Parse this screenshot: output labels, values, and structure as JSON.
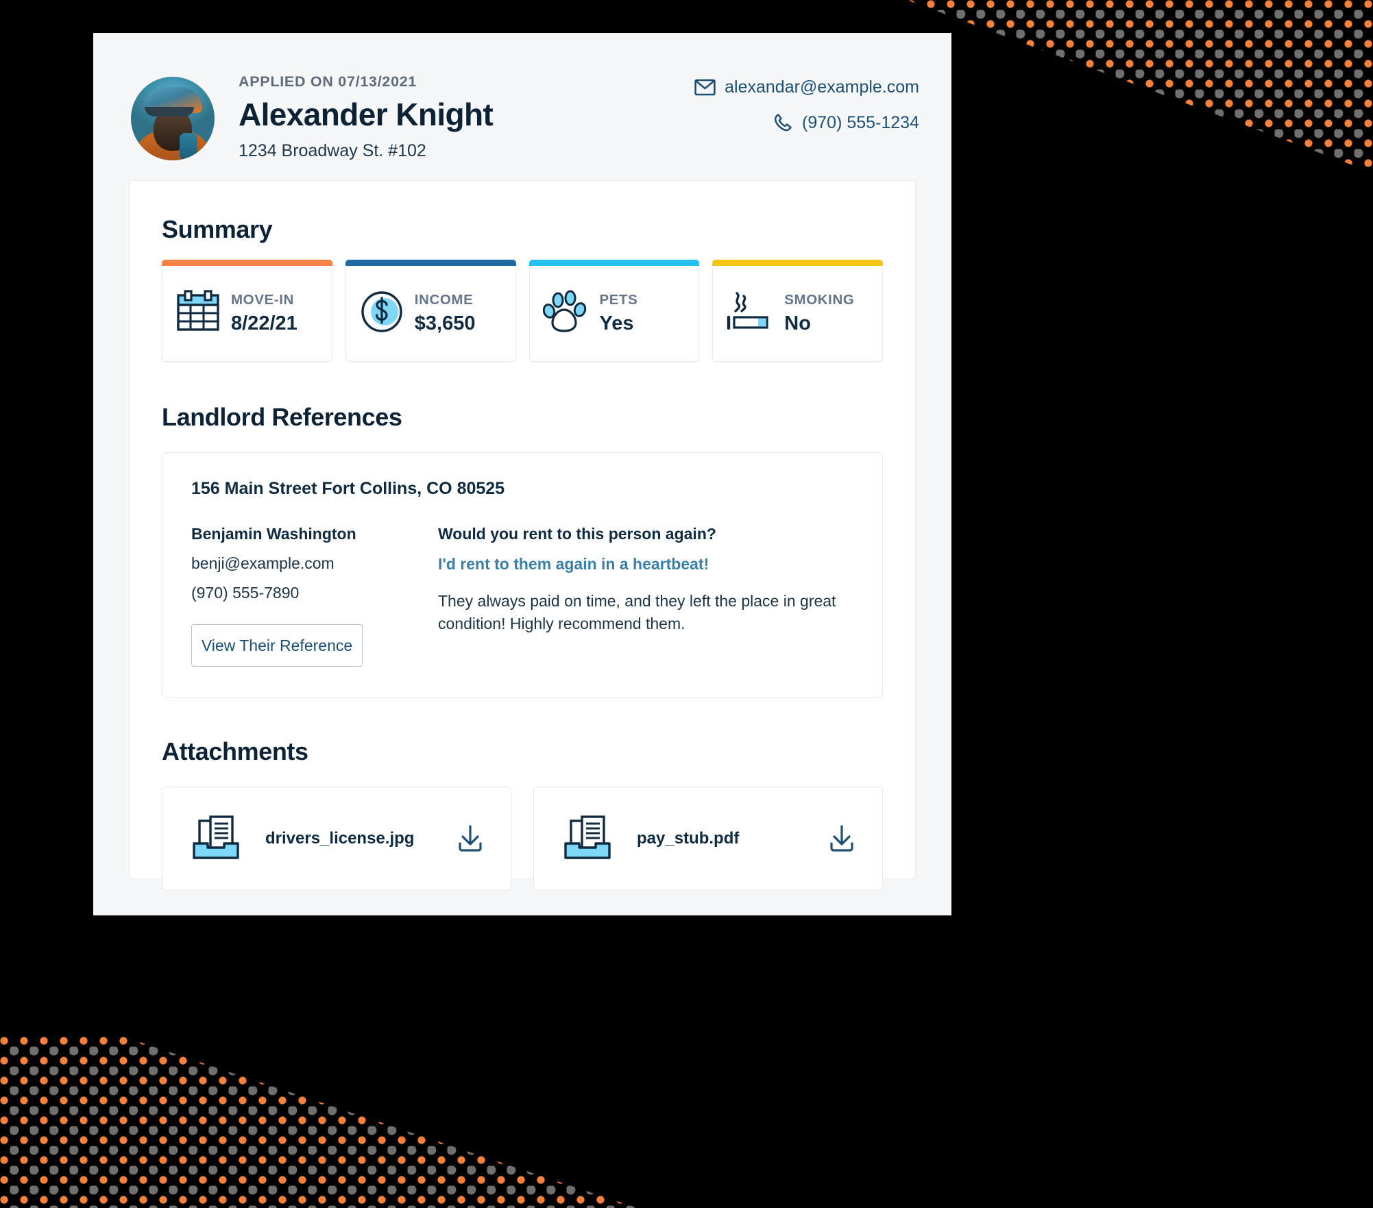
{
  "header": {
    "applied_on": "APPLIED ON 07/13/2021",
    "name": "Alexander Knight",
    "address": "1234 Broadway St. #102",
    "email": "alexandar@example.com",
    "phone": "(970) 555-1234",
    "email_icon": "envelope-icon",
    "phone_icon": "phone-icon",
    "avatar_alt": "applicant-photo"
  },
  "summary": {
    "title": "Summary",
    "cards": [
      {
        "label": "MOVE-IN",
        "value": "8/22/21",
        "accent": "#f58345",
        "icon": "calendar-icon"
      },
      {
        "label": "INCOME",
        "value": "$3,650",
        "accent": "#1f6aa5",
        "icon": "dollar-coin-icon"
      },
      {
        "label": "PETS",
        "value": "Yes",
        "accent": "#23c0f0",
        "icon": "paw-icon"
      },
      {
        "label": "SMOKING",
        "value": "No",
        "accent": "#f6c614",
        "icon": "cigarette-icon"
      }
    ]
  },
  "references": {
    "title": "Landlord References",
    "items": [
      {
        "address": "156 Main Street Fort Collins, CO 80525",
        "name": "Benjamin Washington",
        "email": "benji@example.com",
        "phone": "(970) 555-7890",
        "button_label": "View Their Reference",
        "question": "Would you rent to this person again?",
        "answer": "I'd rent to them again in a heartbeat!",
        "note": "They always paid on time, and they left the place in great condition! Highly recommend them."
      }
    ]
  },
  "attachments": {
    "title": "Attachments",
    "items": [
      {
        "filename": "drivers_license.jpg",
        "file_icon": "document-tray-icon",
        "download_icon": "download-icon"
      },
      {
        "filename": "pay_stub.pdf",
        "file_icon": "document-tray-icon",
        "download_icon": "download-icon"
      }
    ]
  },
  "theme": {
    "ink": "#102b40",
    "link": "#1b4f73",
    "accent_blue": "#7fd7f7",
    "page_bg": "#f6f7f9",
    "dot_orange": "#f5813a"
  }
}
